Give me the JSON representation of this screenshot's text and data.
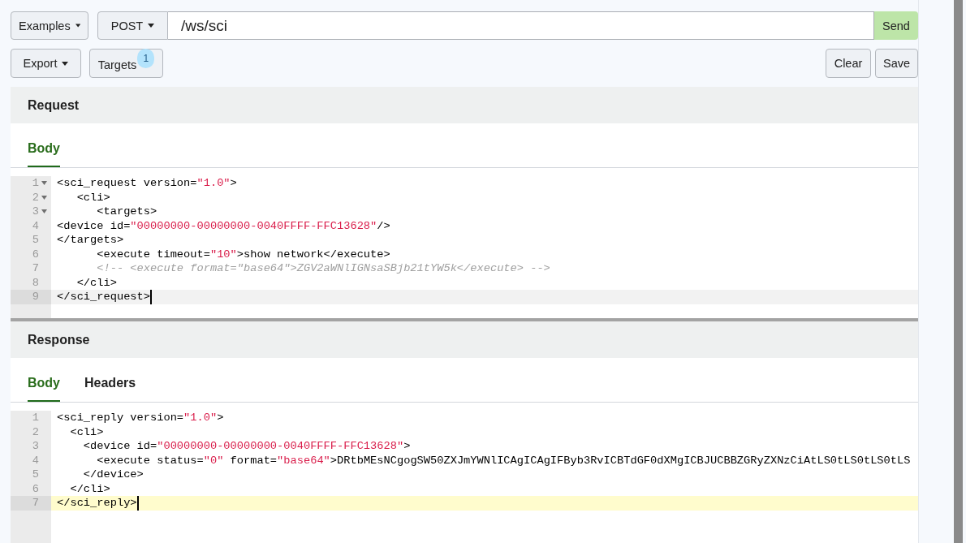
{
  "toolbar": {
    "examples_button": "Examples",
    "method_button": "POST",
    "url": {
      "value": "/ws/sci"
    },
    "send_button": "Send"
  },
  "actions": {
    "export_button": "Export",
    "targets_button": {
      "label": "Targets",
      "badge": "1"
    },
    "clear_button": "Clear",
    "save_button": "Save"
  },
  "request": {
    "title": "Request",
    "tabs": [
      {
        "label": "Body",
        "selected": true
      }
    ],
    "editor": {
      "focused": false,
      "lines": [
        {
          "number": "1",
          "foldable": true,
          "active": false,
          "tokens": [
            {
              "kind": "code",
              "text": "<sci_request version="
            },
            {
              "kind": "string",
              "text": "\"1.0\""
            },
            {
              "kind": "code",
              "text": ">"
            }
          ]
        },
        {
          "number": "2",
          "foldable": true,
          "active": false,
          "tokens": [
            {
              "kind": "code",
              "text": "   <cli>"
            }
          ]
        },
        {
          "number": "3",
          "foldable": true,
          "active": false,
          "tokens": [
            {
              "kind": "code",
              "text": "      <targets>"
            }
          ]
        },
        {
          "number": "4",
          "foldable": false,
          "active": false,
          "tokens": [
            {
              "kind": "code",
              "text": "<device id="
            },
            {
              "kind": "string",
              "text": "\"00000000-00000000-0040FFFF-FFC13628\""
            },
            {
              "kind": "code",
              "text": "/>"
            }
          ]
        },
        {
          "number": "5",
          "foldable": false,
          "active": false,
          "tokens": [
            {
              "kind": "code",
              "text": "</targets>"
            }
          ]
        },
        {
          "number": "6",
          "foldable": false,
          "active": false,
          "tokens": [
            {
              "kind": "code",
              "text": "      <execute timeout="
            },
            {
              "kind": "string",
              "text": "\"10\""
            },
            {
              "kind": "code",
              "text": ">show network</execute>"
            }
          ]
        },
        {
          "number": "7",
          "foldable": false,
          "active": false,
          "tokens": [
            {
              "kind": "comment",
              "text": "      <!-- <execute format=\"base64\">ZGV2aWNlIGNsaSBjb21tYW5k</execute> -->"
            }
          ]
        },
        {
          "number": "8",
          "foldable": false,
          "active": false,
          "tokens": [
            {
              "kind": "code",
              "text": "   </cli>"
            }
          ]
        },
        {
          "number": "9",
          "foldable": false,
          "active": true,
          "tokens": [
            {
              "kind": "code",
              "text": "</sci_request>"
            }
          ]
        }
      ]
    }
  },
  "response": {
    "title": "Response",
    "tabs": [
      {
        "label": "Body",
        "selected": true
      },
      {
        "label": "Headers",
        "selected": false
      }
    ],
    "editor": {
      "focused": true,
      "lines": [
        {
          "number": "1",
          "foldable": false,
          "active": false,
          "tokens": [
            {
              "kind": "code",
              "text": "<sci_reply version="
            },
            {
              "kind": "string",
              "text": "\"1.0\""
            },
            {
              "kind": "code",
              "text": ">"
            }
          ]
        },
        {
          "number": "2",
          "foldable": false,
          "active": false,
          "tokens": [
            {
              "kind": "code",
              "text": "  <cli>"
            }
          ]
        },
        {
          "number": "3",
          "foldable": false,
          "active": false,
          "tokens": [
            {
              "kind": "code",
              "text": "    <device id="
            },
            {
              "kind": "string",
              "text": "\"00000000-00000000-0040FFFF-FFC13628\""
            },
            {
              "kind": "code",
              "text": ">"
            }
          ]
        },
        {
          "number": "4",
          "foldable": false,
          "active": false,
          "tokens": [
            {
              "kind": "code",
              "text": "      <execute status="
            },
            {
              "kind": "string",
              "text": "\"0\""
            },
            {
              "kind": "code",
              "text": " format="
            },
            {
              "kind": "string",
              "text": "\"base64\""
            },
            {
              "kind": "code",
              "text": ">DRtbMEsNCgogSW50ZXJmYWNlICAgICAgIFByb3RvICBTdGF0dXMgICBJUCBBZGRyZXNzCiAtLS0tLS0tLS0tLS"
            }
          ]
        },
        {
          "number": "5",
          "foldable": false,
          "active": false,
          "tokens": [
            {
              "kind": "code",
              "text": "    </device>"
            }
          ]
        },
        {
          "number": "6",
          "foldable": false,
          "active": false,
          "tokens": [
            {
              "kind": "code",
              "text": "  </cli>"
            }
          ]
        },
        {
          "number": "7",
          "foldable": false,
          "active": true,
          "tokens": [
            {
              "kind": "code",
              "text": "</sci_reply>"
            }
          ]
        }
      ]
    }
  }
}
